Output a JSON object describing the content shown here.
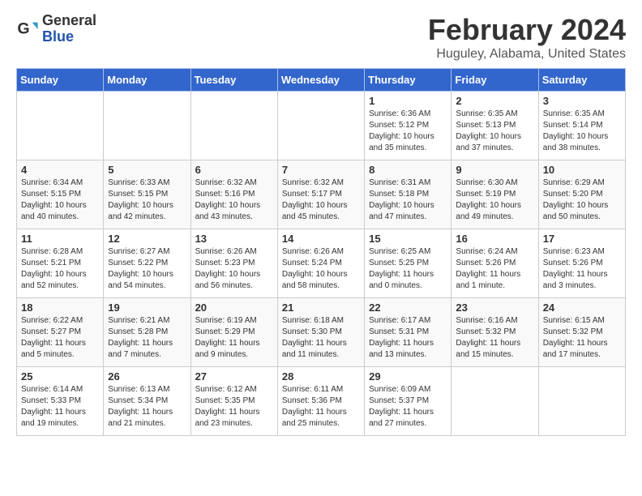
{
  "logo": {
    "general": "General",
    "blue": "Blue"
  },
  "title": {
    "month": "February 2024",
    "location": "Huguley, Alabama, United States"
  },
  "weekdays": [
    "Sunday",
    "Monday",
    "Tuesday",
    "Wednesday",
    "Thursday",
    "Friday",
    "Saturday"
  ],
  "weeks": [
    [
      {
        "day": "",
        "info": ""
      },
      {
        "day": "",
        "info": ""
      },
      {
        "day": "",
        "info": ""
      },
      {
        "day": "",
        "info": ""
      },
      {
        "day": "1",
        "info": "Sunrise: 6:36 AM\nSunset: 5:12 PM\nDaylight: 10 hours\nand 35 minutes."
      },
      {
        "day": "2",
        "info": "Sunrise: 6:35 AM\nSunset: 5:13 PM\nDaylight: 10 hours\nand 37 minutes."
      },
      {
        "day": "3",
        "info": "Sunrise: 6:35 AM\nSunset: 5:14 PM\nDaylight: 10 hours\nand 38 minutes."
      }
    ],
    [
      {
        "day": "4",
        "info": "Sunrise: 6:34 AM\nSunset: 5:15 PM\nDaylight: 10 hours\nand 40 minutes."
      },
      {
        "day": "5",
        "info": "Sunrise: 6:33 AM\nSunset: 5:15 PM\nDaylight: 10 hours\nand 42 minutes."
      },
      {
        "day": "6",
        "info": "Sunrise: 6:32 AM\nSunset: 5:16 PM\nDaylight: 10 hours\nand 43 minutes."
      },
      {
        "day": "7",
        "info": "Sunrise: 6:32 AM\nSunset: 5:17 PM\nDaylight: 10 hours\nand 45 minutes."
      },
      {
        "day": "8",
        "info": "Sunrise: 6:31 AM\nSunset: 5:18 PM\nDaylight: 10 hours\nand 47 minutes."
      },
      {
        "day": "9",
        "info": "Sunrise: 6:30 AM\nSunset: 5:19 PM\nDaylight: 10 hours\nand 49 minutes."
      },
      {
        "day": "10",
        "info": "Sunrise: 6:29 AM\nSunset: 5:20 PM\nDaylight: 10 hours\nand 50 minutes."
      }
    ],
    [
      {
        "day": "11",
        "info": "Sunrise: 6:28 AM\nSunset: 5:21 PM\nDaylight: 10 hours\nand 52 minutes."
      },
      {
        "day": "12",
        "info": "Sunrise: 6:27 AM\nSunset: 5:22 PM\nDaylight: 10 hours\nand 54 minutes."
      },
      {
        "day": "13",
        "info": "Sunrise: 6:26 AM\nSunset: 5:23 PM\nDaylight: 10 hours\nand 56 minutes."
      },
      {
        "day": "14",
        "info": "Sunrise: 6:26 AM\nSunset: 5:24 PM\nDaylight: 10 hours\nand 58 minutes."
      },
      {
        "day": "15",
        "info": "Sunrise: 6:25 AM\nSunset: 5:25 PM\nDaylight: 11 hours\nand 0 minutes."
      },
      {
        "day": "16",
        "info": "Sunrise: 6:24 AM\nSunset: 5:26 PM\nDaylight: 11 hours\nand 1 minute."
      },
      {
        "day": "17",
        "info": "Sunrise: 6:23 AM\nSunset: 5:26 PM\nDaylight: 11 hours\nand 3 minutes."
      }
    ],
    [
      {
        "day": "18",
        "info": "Sunrise: 6:22 AM\nSunset: 5:27 PM\nDaylight: 11 hours\nand 5 minutes."
      },
      {
        "day": "19",
        "info": "Sunrise: 6:21 AM\nSunset: 5:28 PM\nDaylight: 11 hours\nand 7 minutes."
      },
      {
        "day": "20",
        "info": "Sunrise: 6:19 AM\nSunset: 5:29 PM\nDaylight: 11 hours\nand 9 minutes."
      },
      {
        "day": "21",
        "info": "Sunrise: 6:18 AM\nSunset: 5:30 PM\nDaylight: 11 hours\nand 11 minutes."
      },
      {
        "day": "22",
        "info": "Sunrise: 6:17 AM\nSunset: 5:31 PM\nDaylight: 11 hours\nand 13 minutes."
      },
      {
        "day": "23",
        "info": "Sunrise: 6:16 AM\nSunset: 5:32 PM\nDaylight: 11 hours\nand 15 minutes."
      },
      {
        "day": "24",
        "info": "Sunrise: 6:15 AM\nSunset: 5:32 PM\nDaylight: 11 hours\nand 17 minutes."
      }
    ],
    [
      {
        "day": "25",
        "info": "Sunrise: 6:14 AM\nSunset: 5:33 PM\nDaylight: 11 hours\nand 19 minutes."
      },
      {
        "day": "26",
        "info": "Sunrise: 6:13 AM\nSunset: 5:34 PM\nDaylight: 11 hours\nand 21 minutes."
      },
      {
        "day": "27",
        "info": "Sunrise: 6:12 AM\nSunset: 5:35 PM\nDaylight: 11 hours\nand 23 minutes."
      },
      {
        "day": "28",
        "info": "Sunrise: 6:11 AM\nSunset: 5:36 PM\nDaylight: 11 hours\nand 25 minutes."
      },
      {
        "day": "29",
        "info": "Sunrise: 6:09 AM\nSunset: 5:37 PM\nDaylight: 11 hours\nand 27 minutes."
      },
      {
        "day": "",
        "info": ""
      },
      {
        "day": "",
        "info": ""
      }
    ]
  ]
}
